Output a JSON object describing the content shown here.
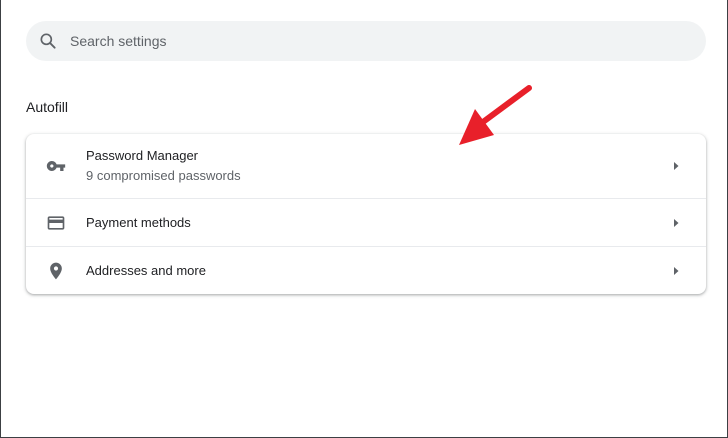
{
  "search": {
    "placeholder": "Search settings",
    "icon": "search-icon"
  },
  "autofill": {
    "title": "Autofill",
    "items": [
      {
        "label": "Password Manager",
        "sublabel": "9 compromised passwords",
        "icon": "key-icon"
      },
      {
        "label": "Payment methods",
        "sublabel": "",
        "icon": "credit-card-icon"
      },
      {
        "label": "Addresses and more",
        "sublabel": "",
        "icon": "location-pin-icon"
      }
    ]
  },
  "colors": {
    "search_bg": "#f1f3f4",
    "text_primary": "#202124",
    "text_secondary": "#5f6368",
    "icon": "#5f6368",
    "divider": "#e8eaed",
    "annotation_arrow": "#e8202a"
  }
}
